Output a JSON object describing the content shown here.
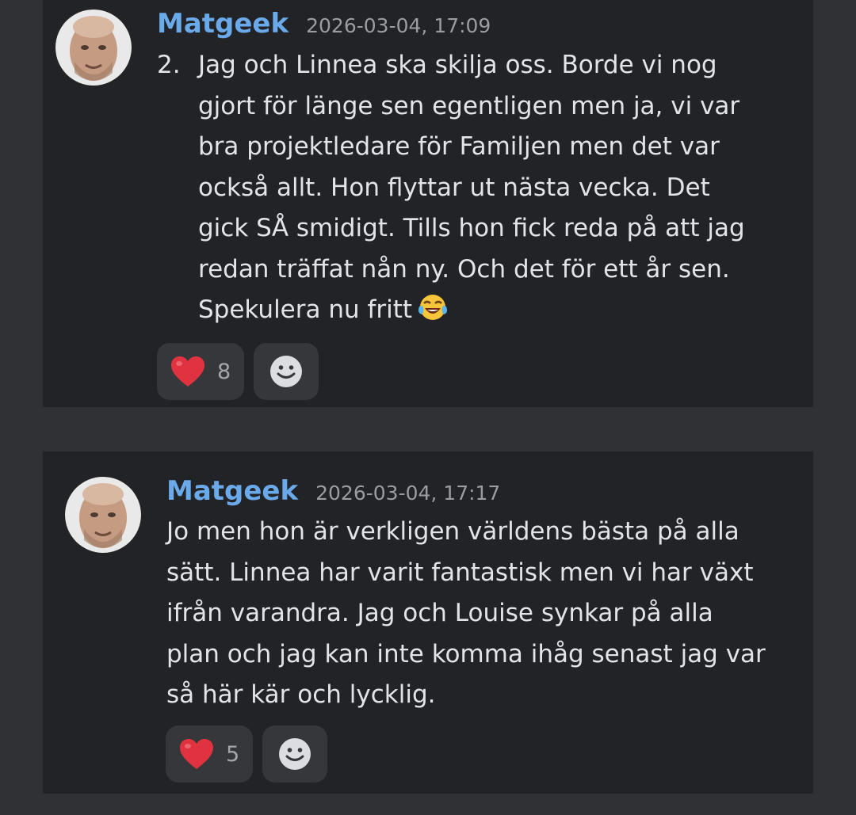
{
  "messages": [
    {
      "author": "Matgeek",
      "timestamp": "2026-03-04, 17:09",
      "list_number": "2.",
      "lines": [
        "Jag och Linnea ska skilja oss. Borde vi nog",
        "gjort för länge sen egentligen men ja, vi var",
        "bra projektledare för Familjen men det var",
        "också allt. Hon flyttar ut nästa vecka. Det",
        "gick SÅ smidigt. Tills hon fick reda på att jag",
        "redan träffat nån ny. Och det för ett år sen.",
        "Spekulera nu fritt"
      ],
      "trailing_emoji": "face-with-tears-of-joy-icon",
      "reactions": {
        "heart_icon": "red-heart-icon",
        "heart_count": "8",
        "add_icon": "smiley-icon"
      }
    },
    {
      "author": "Matgeek",
      "timestamp": "2026-03-04, 17:17",
      "lines": [
        "Jo men hon är verkligen världens bästa på alla",
        "sätt. Linnea har varit fantastisk men vi har växt",
        "ifrån varandra. Jag och Louise synkar på alla",
        "plan och jag kan inte komma ihåg senast jag var",
        "så här kär och lycklig."
      ],
      "reactions": {
        "heart_icon": "red-heart-icon",
        "heart_count": "5",
        "add_icon": "smiley-icon"
      }
    }
  ],
  "colors": {
    "page_background": "#2f3134",
    "card_background": "#222326",
    "author": "#6aa9ea",
    "timestamp": "#9a9ca1",
    "body_text": "#e3e4e7",
    "reaction_pill": "#35373b",
    "heart": "#e0323f"
  }
}
